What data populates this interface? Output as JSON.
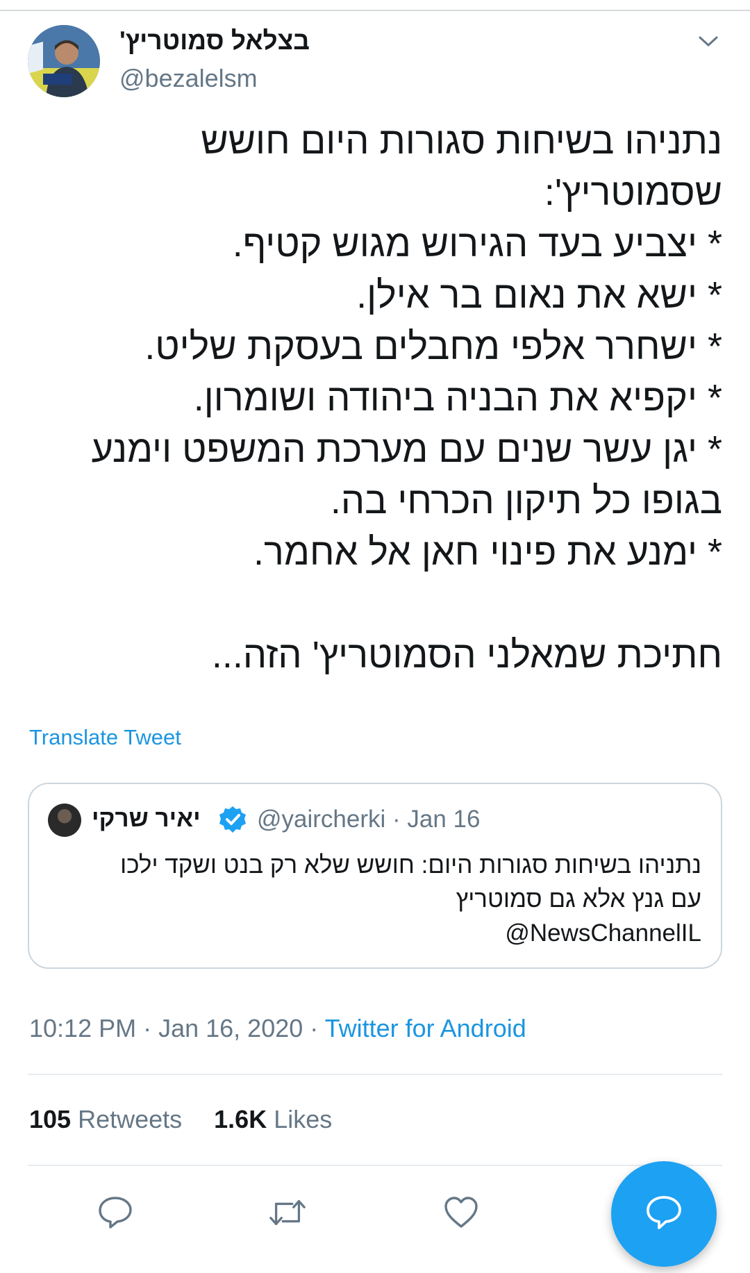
{
  "author": {
    "name": "בצלאל סמוטריץ'",
    "handle": "@bezalelsm"
  },
  "tweet": {
    "lines": [
      "נתניהו בשיחות סגורות היום חושש",
      "שסמוטריץ':",
      "* יצביע בעד הגירוש מגוש קטיף.",
      "* ישא את נאום בר אילן.",
      "* ישחרר אלפי מחבלים בעסקת שליט.",
      "* יקפיא את הבניה ביהודה ושומרון.",
      "* יגן עשר שנים עם מערכת המשפט וימנע",
      "בגופו כל תיקון הכרחי בה.",
      "* ימנע את פינוי חאן אל אחמר.",
      "חתיכת שמאלני הסמוטריץ' הזה..."
    ],
    "translate_label": "Translate Tweet"
  },
  "quoted": {
    "name": "יאיר שרקי",
    "handle_date": "@yaircherki · Jan 16",
    "lines": [
      "נתניהו בשיחות סגורות היום: חושש שלא רק בנט ושקד ילכו",
      "עם גנץ אלא גם סמוטריץ",
      "@NewsChannelIL"
    ]
  },
  "meta": {
    "time_date": "10:12 PM · Jan 16, 2020 · ",
    "source": "Twitter for Android"
  },
  "stats": {
    "retweets_count": "105",
    "retweets_label": " Retweets",
    "likes_count": "1.6K",
    "likes_label": " Likes"
  },
  "colors": {
    "accent": "#1da1f2",
    "link": "#1b95e0",
    "secondary_text": "#657786",
    "divider": "#e6ecf0"
  },
  "icons": {
    "caret": "chevron-down-icon",
    "verified": "verified-badge-icon",
    "reply": "reply-icon",
    "retweet": "retweet-icon",
    "like": "heart-icon",
    "compose": "compose-reply-icon"
  }
}
